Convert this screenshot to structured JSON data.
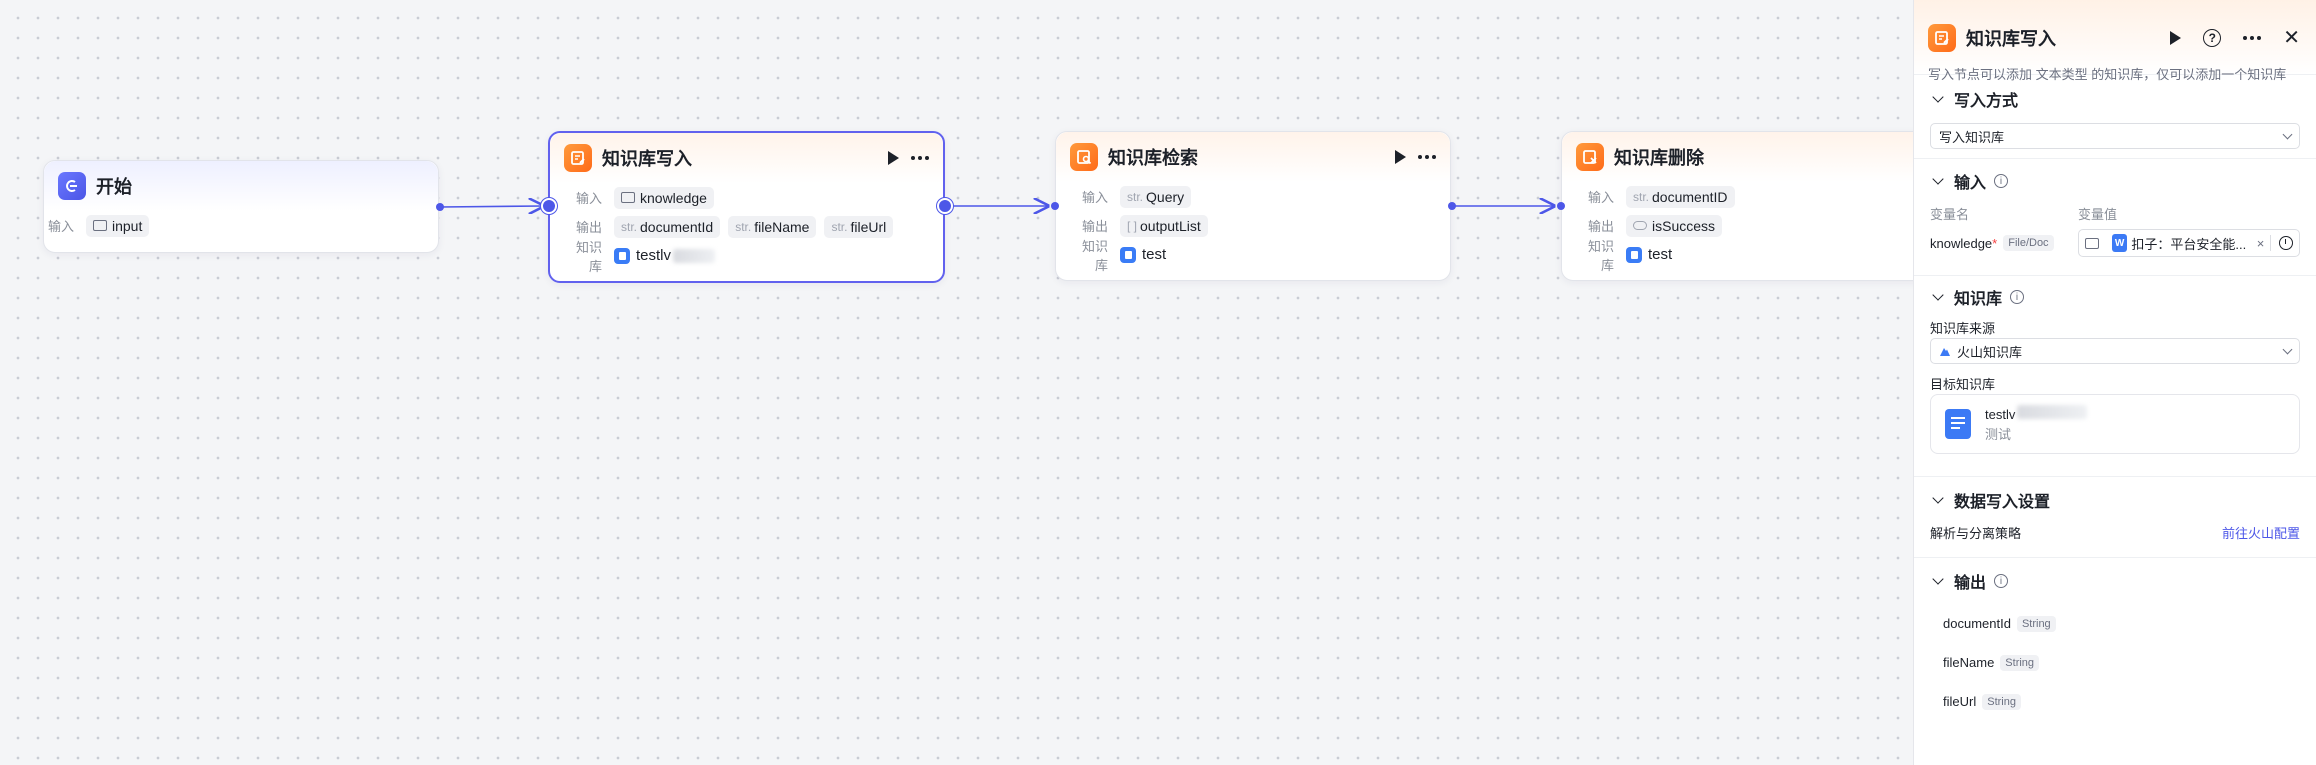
{
  "nodes": {
    "start": {
      "title": "开始",
      "input_label": "输入",
      "input_value": "input"
    },
    "kb_write": {
      "title": "知识库写入",
      "input_label": "输入",
      "input_value": "knowledge",
      "output_label": "输出",
      "outputs": [
        {
          "type": "str.",
          "name": "documentId"
        },
        {
          "type": "str.",
          "name": "fileName"
        },
        {
          "type": "str.",
          "name": "fileUrl"
        }
      ],
      "kb_label": "知识库",
      "kb_name": "testlv"
    },
    "kb_search": {
      "title": "知识库检索",
      "input_label": "输入",
      "input_type": "str.",
      "input_value": "Query",
      "output_label": "输出",
      "output_type": "[ ]",
      "output_value": "outputList",
      "kb_label": "知识库",
      "kb_name": "test"
    },
    "kb_delete": {
      "title": "知识库删除",
      "input_label": "输入",
      "input_type": "str.",
      "input_value": "documentID",
      "output_label": "输出",
      "output_value": "isSuccess",
      "kb_label": "知识库",
      "kb_name": "test"
    }
  },
  "panel": {
    "title": "知识库写入",
    "description": "写入节点可以添加 文本类型 的知识库，仅可以添加一个知识库",
    "write_mode": {
      "section": "写入方式",
      "value": "写入知识库"
    },
    "input": {
      "section": "输入",
      "col_name": "变量名",
      "col_value": "变量值",
      "var_name": "knowledge",
      "required_mark": "*",
      "var_type": "File/Doc",
      "value_text": "扣子：平台安全能...",
      "value_icon_letter": "W",
      "clear": "×"
    },
    "kb": {
      "section": "知识库",
      "source_label": "知识库来源",
      "source_value": "火山知识库",
      "target_label": "目标知识库",
      "card_name": "testlv",
      "card_desc": "测试"
    },
    "data_write": {
      "section": "数据写入设置",
      "strategy_label": "解析与分离策略",
      "link": "前往火山配置"
    },
    "output": {
      "section": "输出",
      "fields": [
        {
          "name": "documentId",
          "type": "String"
        },
        {
          "name": "fileName",
          "type": "String"
        },
        {
          "name": "fileUrl",
          "type": "String"
        }
      ]
    },
    "info_glyph": "i",
    "help_glyph": "?",
    "close_glyph": "✕"
  },
  "colors": {
    "accent": "#4d57e8",
    "orange": "#ff7a1f",
    "link": "#4d57e8"
  }
}
